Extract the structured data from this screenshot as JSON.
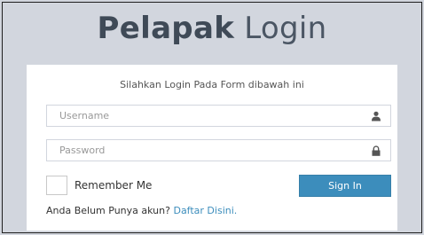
{
  "header": {
    "title_bold": "Pelapak",
    "title_light": "Login"
  },
  "form": {
    "message": "Silahkan Login Pada Form dibawah ini",
    "username_placeholder": "Username",
    "username_value": "",
    "password_placeholder": "Password",
    "password_value": "",
    "username_icon": "user-icon",
    "password_icon": "lock-icon",
    "remember_label": "Remember Me",
    "remember_checked": false,
    "signin_label": "Sign In",
    "register_text": "Anda Belum Punya akun?",
    "register_link": "Daftar Disini."
  },
  "colors": {
    "background": "#d2d6de",
    "accent": "#3c8dbc",
    "title": "#3f4a57"
  }
}
